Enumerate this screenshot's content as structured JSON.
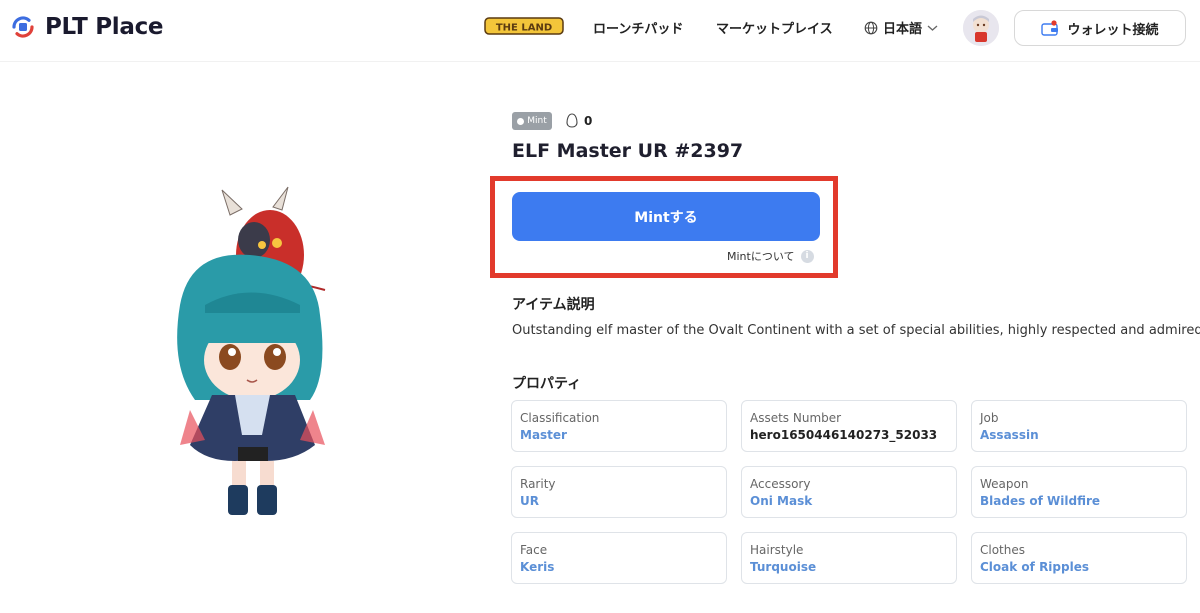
{
  "header": {
    "brand": "PLT Place",
    "theland_logo": "THE LAND",
    "nav": {
      "launchpad": "ローンチパッド",
      "marketplace": "マーケットプレイス"
    },
    "language": "日本語",
    "wallet_button": "ウォレット接続"
  },
  "item": {
    "badge": "Mint",
    "likes": "0",
    "title": "ELF Master UR #2397",
    "mint_button": "Mintする",
    "about_mint": "Mintについて",
    "description_heading": "アイテム説明",
    "description": "Outstanding elf master of the Ovalt Continent with a set of special abilities, highly respected and admired.",
    "properties_heading": "プロパティ",
    "properties": [
      {
        "label": "Classification",
        "value": "Master"
      },
      {
        "label": "Assets Number",
        "value": "hero1650446140273_52033"
      },
      {
        "label": "Job",
        "value": "Assassin"
      },
      {
        "label": "Rarity",
        "value": "UR"
      },
      {
        "label": "Accessory",
        "value": "Oni Mask"
      },
      {
        "label": "Weapon",
        "value": "Blades of Wildfire"
      },
      {
        "label": "Face",
        "value": "Keris"
      },
      {
        "label": "Hairstyle",
        "value": "Turquoise"
      },
      {
        "label": "Clothes",
        "value": "Cloak of Ripples"
      }
    ]
  },
  "colors": {
    "accent": "#3d7bf0",
    "highlight": "#e23a2c",
    "property_value": "#5b8fd6"
  }
}
